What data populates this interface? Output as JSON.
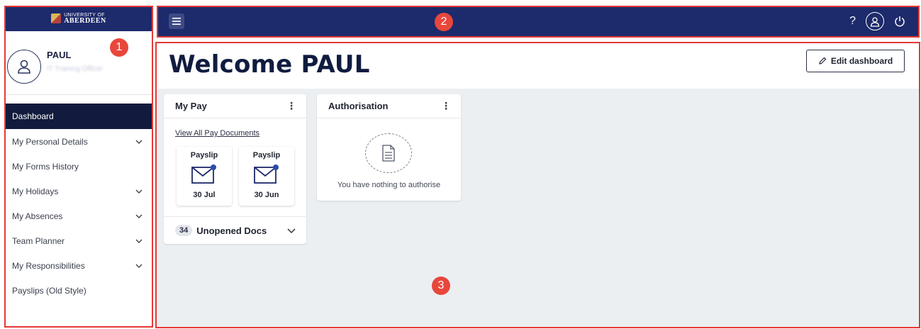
{
  "logo": {
    "line1": "UNIVERSITY OF",
    "line2": "ABERDEEN"
  },
  "user": {
    "name": "PAUL",
    "role": "IT Training Officer"
  },
  "sidebar": {
    "items": [
      {
        "label": "Dashboard",
        "active": true,
        "expandable": false
      },
      {
        "label": "My Personal Details",
        "expandable": true
      },
      {
        "label": "My Forms History",
        "expandable": false
      },
      {
        "label": "My Holidays",
        "expandable": true
      },
      {
        "label": "My Absences",
        "expandable": true
      },
      {
        "label": "Team Planner",
        "expandable": true
      },
      {
        "label": "My Responsibilities",
        "expandable": true
      },
      {
        "label": "Payslips (Old Style)",
        "expandable": false
      }
    ]
  },
  "topbar": {
    "help": "?"
  },
  "main": {
    "welcome": "Welcome PAUL",
    "edit_label": "Edit dashboard"
  },
  "pay_card": {
    "title": "My Pay",
    "link": "View All Pay Documents",
    "payslips": [
      {
        "title": "Payslip",
        "date": "30 Jul"
      },
      {
        "title": "Payslip",
        "date": "30 Jun"
      }
    ],
    "unopened_count": "34",
    "unopened_label": "Unopened Docs"
  },
  "auth_card": {
    "title": "Authorisation",
    "message": "You have nothing to authorise"
  },
  "markers": [
    "1",
    "2",
    "3"
  ],
  "colors": {
    "navy": "#1d2a6b",
    "active_nav": "#121b3d",
    "outline": "#e53935",
    "marker": "#e8473c",
    "background": "#eceff2"
  }
}
